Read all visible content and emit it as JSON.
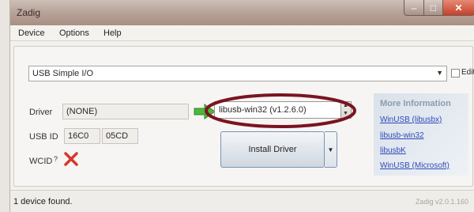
{
  "window": {
    "title": "Zadig"
  },
  "caption_buttons": {
    "minimize": "–",
    "maximize": "□",
    "close": "✕"
  },
  "menu": {
    "items": [
      "Device",
      "Options",
      "Help"
    ]
  },
  "device_selector": {
    "value": "USB Simple I/O",
    "arrow_icon": "dropdown-arrow"
  },
  "edit_checkbox": {
    "label": "Edit",
    "checked": false
  },
  "driver": {
    "label": "Driver",
    "value": "(NONE)"
  },
  "usb_id": {
    "label": "USB ID",
    "vid": "16C0",
    "pid": "05CD"
  },
  "wcid": {
    "label": "WCID",
    "help_mark": "?",
    "status_icon": "red-x-icon"
  },
  "target_driver": {
    "value": "libusb-win32 (v1.2.6.0)",
    "arrow_color": "#4fb63a",
    "highlight_color": "#7a1420"
  },
  "install_button": {
    "label": "Install Driver",
    "split_arrow": "▼"
  },
  "info": {
    "title": "More Information",
    "links": [
      "WinUSB (libusbx)",
      "libusb-win32",
      "libusbK",
      "WinUSB (Microsoft)"
    ]
  },
  "status": {
    "message": "1 device found.",
    "version": "Zadig v2.0.1.160"
  }
}
